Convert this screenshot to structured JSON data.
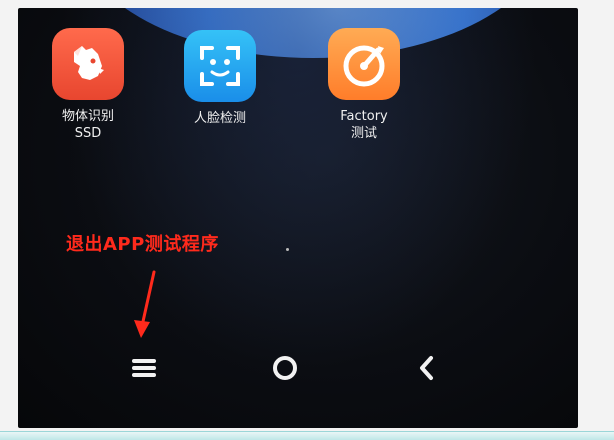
{
  "apps": [
    {
      "label": "物体识别\nSSD",
      "icon": "dog-icon",
      "color": "#ef5336"
    },
    {
      "label": "人脸检测",
      "icon": "face-scan-icon",
      "color": "#27a7f0"
    },
    {
      "label": "Factory\n测试",
      "icon": "gauge-icon",
      "color": "#ff9540"
    }
  ],
  "annotation": {
    "text": "退出APP测试程序",
    "color": "#ff2a1c",
    "arrow_icon": "red-arrow-down-icon"
  },
  "navbar": {
    "menu_icon": "menu-icon",
    "home_icon": "home-circle-icon",
    "back_icon": "back-chevron-icon"
  }
}
